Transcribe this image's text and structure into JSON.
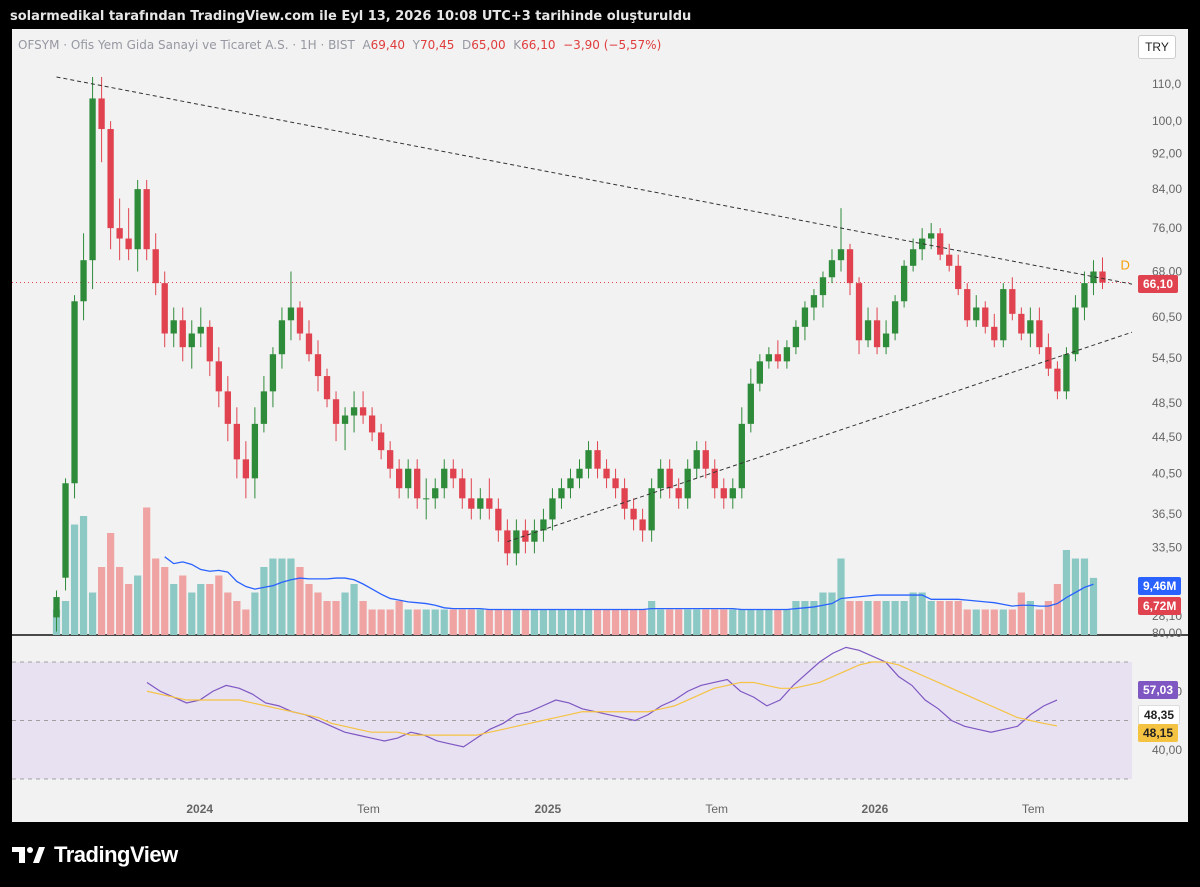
{
  "header": {
    "caption": "solarmedikal tarafından TradingView.com ile Eyl 13, 2026 10:08 UTC+3 tarihinde oluşturuldu"
  },
  "symbol": {
    "name": "OFSYM · Ofis Yem Gida Sanayi ve Ticaret A.S. · 1H · BIST",
    "open_label": "A",
    "open": "69,40",
    "high_label": "Y",
    "high": "70,45",
    "low_label": "D",
    "low": "65,00",
    "close_label": "K",
    "close": "66,10",
    "change": "−3,90 (−5,57%)"
  },
  "currency": "TRY",
  "tags": {
    "last_price": "66,10",
    "volume_ma": "9,46M",
    "volume": "6,72M",
    "rsi": "57,03",
    "rsi_mid": "48,35",
    "rsi_ma": "48,15"
  },
  "marker_label": "D",
  "footer": {
    "brand": "TradingView"
  },
  "colors": {
    "up": "#2e8b3a",
    "down": "#e0434f",
    "vol_up": "#8dc9c4",
    "vol_down": "#f0a3a3",
    "vol_ma": "#2962ff",
    "rsi": "#7e57c2",
    "rsi_ma": "#f5c342",
    "rsi_band": "#e8e1f2"
  },
  "chart_data": {
    "type": "candlestick",
    "interval": "1H",
    "price_axis_ticks": [
      "110,0",
      "100,0",
      "92,00",
      "84,00",
      "76,00",
      "68,00",
      "60,50",
      "54,50",
      "48,50",
      "44,50",
      "40,50",
      "36,50",
      "33,50",
      "28,10"
    ],
    "time_axis_labels": [
      "2024",
      "Tem",
      "2025",
      "Tem",
      "2026",
      "Tem"
    ],
    "rsi_axis_ticks": [
      "80,00",
      "60,00",
      "40,00"
    ],
    "ohlc": [
      [
        28,
        30,
        27,
        29.5
      ],
      [
        31,
        40,
        30,
        39.5
      ],
      [
        39.5,
        64,
        38,
        63
      ],
      [
        63,
        75,
        60,
        70
      ],
      [
        70,
        112,
        65,
        106
      ],
      [
        106,
        112,
        90,
        98
      ],
      [
        98,
        100,
        72,
        76
      ],
      [
        76,
        82,
        70,
        74
      ],
      [
        74,
        80,
        70,
        72
      ],
      [
        72,
        86,
        68,
        84
      ],
      [
        84,
        86,
        70,
        72
      ],
      [
        72,
        75,
        64,
        66
      ],
      [
        66,
        68,
        56,
        58
      ],
      [
        58,
        62,
        56,
        60
      ],
      [
        60,
        62,
        54,
        56
      ],
      [
        56,
        60,
        53,
        58
      ],
      [
        58,
        62,
        56,
        59
      ],
      [
        59,
        60,
        52,
        54
      ],
      [
        54,
        56,
        48,
        50
      ],
      [
        50,
        52,
        44,
        46
      ],
      [
        46,
        48,
        40,
        42
      ],
      [
        42,
        44,
        38,
        40
      ],
      [
        40,
        48,
        38,
        46
      ],
      [
        46,
        52,
        45,
        50
      ],
      [
        50,
        56,
        48,
        55
      ],
      [
        55,
        62,
        53,
        60
      ],
      [
        60,
        68,
        57,
        62
      ],
      [
        62,
        63,
        57,
        58
      ],
      [
        58,
        60,
        54,
        55
      ],
      [
        55,
        57,
        50,
        52
      ],
      [
        52,
        53,
        48,
        49
      ],
      [
        49,
        50,
        44,
        46
      ],
      [
        46,
        48,
        43,
        47
      ],
      [
        47,
        50,
        45,
        48
      ],
      [
        48,
        50,
        46,
        47
      ],
      [
        47,
        48,
        44,
        45
      ],
      [
        45,
        46,
        42,
        43
      ],
      [
        43,
        44,
        40,
        41
      ],
      [
        41,
        42,
        38,
        39
      ],
      [
        39,
        42,
        38,
        41
      ],
      [
        41,
        42,
        37,
        38
      ],
      [
        38,
        40,
        36,
        38
      ],
      [
        38,
        40,
        37,
        39
      ],
      [
        39,
        42,
        38,
        41
      ],
      [
        41,
        42,
        39,
        40
      ],
      [
        40,
        41,
        37,
        38
      ],
      [
        38,
        40,
        36,
        37
      ],
      [
        37,
        39,
        36,
        38
      ],
      [
        38,
        40,
        36,
        37
      ],
      [
        37,
        38,
        34,
        35
      ],
      [
        35,
        36,
        32,
        33
      ],
      [
        33,
        36,
        32,
        35
      ],
      [
        35,
        36,
        33,
        34
      ],
      [
        34,
        36,
        33,
        35
      ],
      [
        35,
        37,
        34,
        36
      ],
      [
        36,
        39,
        35,
        38
      ],
      [
        38,
        40,
        37,
        39
      ],
      [
        39,
        41,
        38,
        40
      ],
      [
        40,
        42,
        39,
        41
      ],
      [
        41,
        44,
        40,
        43
      ],
      [
        43,
        44,
        40,
        41
      ],
      [
        41,
        42,
        39,
        40
      ],
      [
        40,
        41,
        38,
        39
      ],
      [
        39,
        40,
        36,
        37
      ],
      [
        37,
        38,
        35,
        36
      ],
      [
        36,
        37,
        34,
        35
      ],
      [
        35,
        40,
        34,
        39
      ],
      [
        39,
        42,
        38,
        41
      ],
      [
        41,
        42,
        38,
        39
      ],
      [
        39,
        40,
        37,
        38
      ],
      [
        38,
        42,
        37,
        41
      ],
      [
        41,
        44,
        40,
        43
      ],
      [
        43,
        44,
        40,
        41
      ],
      [
        41,
        42,
        38,
        39
      ],
      [
        39,
        40,
        37,
        38
      ],
      [
        38,
        40,
        37,
        39
      ],
      [
        39,
        48,
        38,
        46
      ],
      [
        46,
        53,
        45,
        51
      ],
      [
        51,
        55,
        50,
        54
      ],
      [
        54,
        56,
        53,
        55
      ],
      [
        55,
        57,
        53,
        54
      ],
      [
        54,
        57,
        53,
        56
      ],
      [
        56,
        60,
        55,
        59
      ],
      [
        59,
        63,
        57,
        62
      ],
      [
        62,
        65,
        60,
        64
      ],
      [
        64,
        68,
        62,
        67
      ],
      [
        67,
        72,
        66,
        70
      ],
      [
        70,
        80,
        68,
        72
      ],
      [
        72,
        73,
        64,
        66
      ],
      [
        66,
        67,
        55,
        57
      ],
      [
        57,
        62,
        56,
        60
      ],
      [
        60,
        62,
        55,
        56
      ],
      [
        56,
        60,
        55,
        58
      ],
      [
        58,
        64,
        57,
        63
      ],
      [
        63,
        70,
        62,
        69
      ],
      [
        69,
        74,
        68,
        72
      ],
      [
        72,
        76,
        70,
        74
      ],
      [
        74,
        77,
        72,
        75
      ],
      [
        75,
        76,
        70,
        71
      ],
      [
        71,
        73,
        68,
        69
      ],
      [
        69,
        71,
        64,
        65
      ],
      [
        65,
        66,
        59,
        60
      ],
      [
        60,
        64,
        59,
        62
      ],
      [
        62,
        63,
        58,
        59
      ],
      [
        59,
        61,
        56,
        57
      ],
      [
        57,
        66,
        56,
        65
      ],
      [
        65,
        67,
        60,
        61
      ],
      [
        61,
        62,
        57,
        58
      ],
      [
        58,
        62,
        56,
        60
      ],
      [
        60,
        62,
        55,
        56
      ],
      [
        56,
        58,
        52,
        53
      ],
      [
        53,
        54,
        49,
        50
      ],
      [
        50,
        56,
        49,
        55
      ],
      [
        55,
        64,
        54,
        62
      ],
      [
        62,
        68,
        60,
        66
      ],
      [
        66,
        70,
        64,
        68
      ],
      [
        68,
        70.5,
        65,
        66.1
      ]
    ],
    "volume_millions": [
      3,
      4,
      13,
      14,
      5,
      8,
      12,
      8,
      6,
      7,
      15,
      9,
      8,
      6,
      7,
      5,
      6,
      6,
      7,
      5,
      4,
      3,
      5,
      8,
      9,
      9,
      9,
      8,
      6,
      5,
      4,
      4,
      5,
      6,
      4,
      3,
      3,
      3,
      4,
      3,
      3,
      3,
      3,
      3,
      3,
      3,
      3,
      3,
      3,
      3,
      3,
      3,
      3,
      3,
      3,
      3,
      3,
      3,
      3,
      3,
      3,
      3,
      3,
      3,
      3,
      3,
      4,
      3,
      3,
      3,
      3,
      3,
      3,
      3,
      3,
      3,
      3,
      3,
      3,
      3,
      3,
      3,
      4,
      4,
      4,
      5,
      5,
      9,
      4,
      4,
      4,
      4,
      4,
      4,
      4,
      5,
      5,
      4,
      4,
      4,
      4,
      3,
      3,
      3,
      3,
      3,
      3,
      5,
      4,
      3,
      4,
      6,
      10,
      9,
      9,
      6.72
    ],
    "rsi": [
      63,
      60,
      58,
      56,
      57,
      60,
      62,
      61,
      59,
      56,
      55,
      53,
      52,
      50,
      48,
      46,
      45,
      44,
      43,
      44,
      46,
      45,
      43,
      42,
      41,
      44,
      47,
      49,
      52,
      53,
      55,
      57,
      56,
      54,
      53,
      52,
      51,
      50,
      52,
      55,
      57,
      60,
      62,
      63,
      64,
      60,
      58,
      55,
      57,
      62,
      66,
      70,
      73,
      75,
      74,
      72,
      70,
      65,
      62,
      57,
      54,
      50,
      48,
      47,
      46,
      47,
      48,
      52,
      55,
      57
    ],
    "rsi_ma": [
      60,
      59,
      58,
      57,
      57,
      57,
      57,
      57,
      56,
      55,
      54,
      53,
      52,
      51,
      49,
      48,
      47,
      46,
      46,
      46,
      45,
      45,
      45,
      45,
      45,
      45,
      46,
      47,
      48,
      49,
      50,
      51,
      52,
      53,
      53,
      53,
      53,
      53,
      53,
      54,
      55,
      57,
      59,
      61,
      62,
      63,
      63,
      62,
      61,
      61,
      62,
      63,
      65,
      67,
      69,
      70,
      70,
      69,
      67,
      65,
      63,
      61,
      59,
      57,
      55,
      53,
      51,
      50,
      49,
      48.15
    ],
    "trendlines": [
      {
        "name": "upper",
        "from": {
          "bar": 0,
          "price": 112
        },
        "to": {
          "bar": 112,
          "price": 68
        }
      },
      {
        "name": "lower",
        "from": {
          "bar": 50,
          "price": 34
        },
        "to": {
          "bar": 112,
          "price": 55
        }
      }
    ]
  }
}
